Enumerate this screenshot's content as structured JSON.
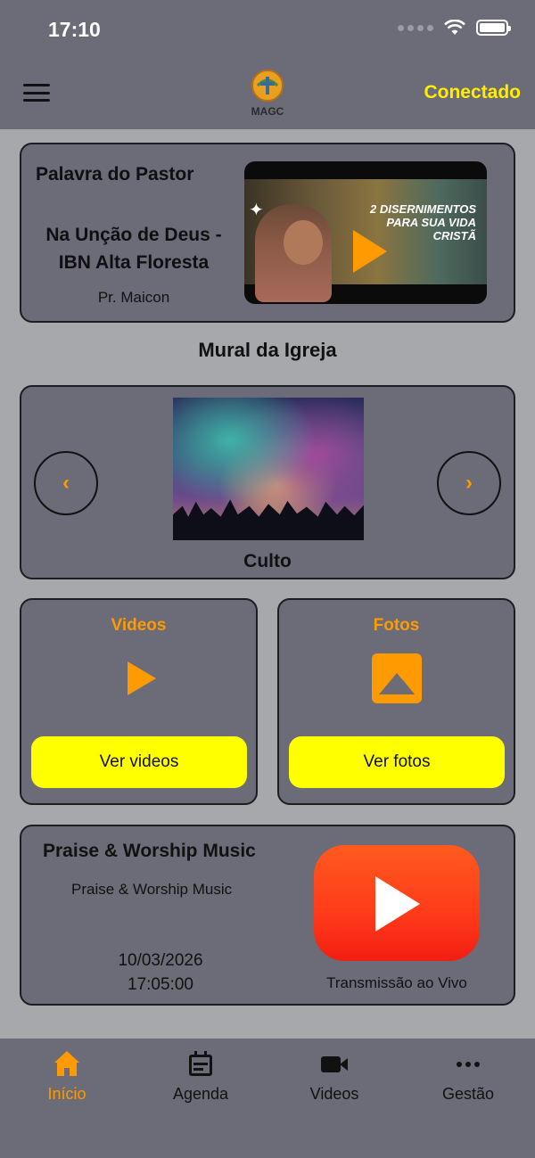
{
  "status_bar": {
    "time": "17:10"
  },
  "header": {
    "logo_text": "MAGC",
    "connection_status": "Conectado"
  },
  "pastor_card": {
    "title": "Palavra do Pastor",
    "sermon_title": "Na Unção de Deus - IBN Alta Floresta",
    "pastor_name": "Pr. Maicon",
    "thumbnail_text": "2 DISERNIMENTOS PARA SUA VIDA CRISTÃ"
  },
  "mural": {
    "title": "Mural da Igreja",
    "caption": "Culto",
    "prev_icon": "chevron-left-icon",
    "next_icon": "chevron-right-icon"
  },
  "videos_card": {
    "title": "Videos",
    "button_label": "Ver videos",
    "icon": "play-icon"
  },
  "fotos_card": {
    "title": "Fotos",
    "button_label": "Ver fotos",
    "icon": "image-icon"
  },
  "live_card": {
    "title": "Praise & Worship Music",
    "subtitle": "Praise & Worship Music",
    "date": "10/03/2026",
    "time": "17:05:00",
    "caption": "Transmissão ao Vivo",
    "icon": "youtube-icon"
  },
  "tabbar": {
    "items": [
      {
        "label": "Início",
        "icon": "home-icon",
        "active": true
      },
      {
        "label": "Agenda",
        "icon": "calendar-icon",
        "active": false
      },
      {
        "label": "Videos",
        "icon": "video-camera-icon",
        "active": false
      },
      {
        "label": "Gestão",
        "icon": "more-icon",
        "active": false
      }
    ]
  },
  "colors": {
    "accent": "#ff9a00",
    "connected": "#ffee00",
    "button": "#ffff00",
    "card": "#6b6c77",
    "background": "#a6a8ab"
  }
}
